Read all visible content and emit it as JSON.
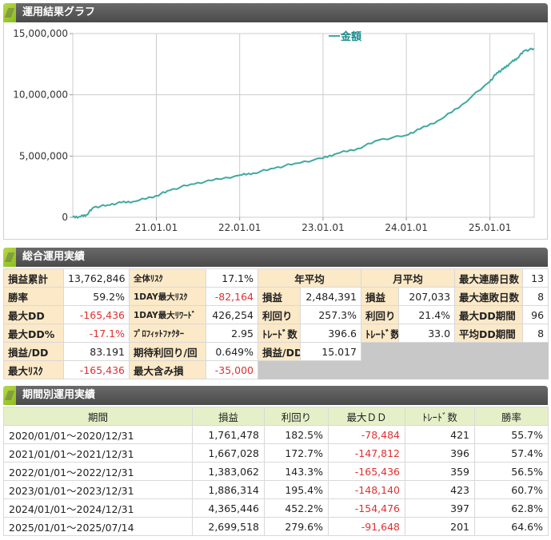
{
  "headers": {
    "chart": "運用結果グラフ",
    "summary": "総合運用実績",
    "period": "期間別運用実績"
  },
  "chart_data": {
    "type": "line",
    "title": "",
    "xlabel": "",
    "ylabel": "",
    "ylim": [
      0,
      15000000
    ],
    "yticks": [
      0,
      5000000,
      10000000,
      15000000
    ],
    "ytick_labels": [
      "0",
      "5,000,000",
      "10,000,000",
      "15,000,000"
    ],
    "xlim": [
      "2020-01-01",
      "2025-07-14"
    ],
    "xtick_labels": [
      "21.01.01",
      "22.01.01",
      "23.01.01",
      "24.01.01",
      "25.01.01"
    ],
    "grid": true,
    "legend": "top-center",
    "line_color": "#3fa9a0",
    "series": [
      {
        "name": "金額",
        "x": [
          "2020-01-01",
          "2020-02-01",
          "2020-03-01",
          "2020-04-01",
          "2020-06-01",
          "2020-08-01",
          "2020-10-01",
          "2020-12-31",
          "2021-03-01",
          "2021-06-01",
          "2021-09-01",
          "2021-12-31",
          "2022-03-01",
          "2022-06-01",
          "2022-09-01",
          "2022-12-31",
          "2023-03-01",
          "2023-06-01",
          "2023-09-01",
          "2023-12-31",
          "2024-03-01",
          "2024-06-01",
          "2024-09-01",
          "2024-12-31",
          "2025-02-01",
          "2025-03-01",
          "2025-04-01",
          "2025-05-01",
          "2025-06-01",
          "2025-07-14"
        ],
        "values": [
          0,
          50000,
          200000,
          800000,
          1000000,
          1200000,
          1300000,
          1761478,
          2200000,
          2700000,
          3000000,
          3428506,
          3600000,
          4000000,
          4400000,
          4811568,
          5200000,
          5600000,
          6300000,
          6697882,
          7200000,
          8000000,
          9200000,
          11063328,
          11800000,
          12100000,
          12600000,
          13000000,
          13600000,
          13762846
        ]
      }
    ]
  },
  "summary": {
    "rows": [
      [
        {
          "label": "損益累計"
        },
        {
          "value": "13,762,846"
        },
        {
          "label": "全体ﾘｽｸ",
          "small": true
        },
        {
          "value": "17.1%"
        },
        {
          "header": "年平均",
          "span": 2
        },
        {
          "header": "月平均",
          "span": 2
        },
        {
          "label": "最大連勝日数"
        },
        {
          "value": "13"
        }
      ],
      [
        {
          "label": "勝率"
        },
        {
          "value": "59.2%"
        },
        {
          "label": "1DAY最大ﾘｽｸ",
          "small": true
        },
        {
          "value": "-82,164",
          "neg": true
        },
        {
          "label": "損益"
        },
        {
          "value": "2,484,391"
        },
        {
          "label": "損益"
        },
        {
          "value": "207,033"
        },
        {
          "label": "最大連敗日数"
        },
        {
          "value": "8"
        }
      ],
      [
        {
          "label": "最大DD"
        },
        {
          "value": "-165,436",
          "neg": true
        },
        {
          "label": "1DAY最大ﾘﾜｰﾄﾞ",
          "small": true
        },
        {
          "value": "426,254"
        },
        {
          "label": "利回り"
        },
        {
          "value": "257.3%"
        },
        {
          "label": "利回り"
        },
        {
          "value": "21.4%"
        },
        {
          "label": "最大DD期間"
        },
        {
          "value": "96"
        }
      ],
      [
        {
          "label": "最大DD%"
        },
        {
          "value": "-17.1%",
          "neg": true
        },
        {
          "label": "ﾌﾟﾛﾌｨｯﾄﾌｧｸﾀｰ",
          "small": true
        },
        {
          "value": "2.95"
        },
        {
          "label": "ﾄﾚｰﾄﾞ数"
        },
        {
          "value": "396.6"
        },
        {
          "label": "ﾄﾚｰﾄﾞ数"
        },
        {
          "value": "33.0"
        },
        {
          "label": "平均DD期間"
        },
        {
          "value": "8"
        }
      ],
      [
        {
          "label": "損益/DD"
        },
        {
          "value": "83.191"
        },
        {
          "label": "期待利回り/回"
        },
        {
          "value": "0.649%"
        },
        {
          "label": "損益/DD"
        },
        {
          "value": "15.017"
        },
        {
          "gray": true,
          "span": 4
        }
      ],
      [
        {
          "label": "最大ﾘｽｸ"
        },
        {
          "value": "-165,436",
          "neg": true
        },
        {
          "label": "最大含み損"
        },
        {
          "value": "-35,000",
          "neg": true
        },
        {
          "gray": true,
          "span": 6
        }
      ]
    ]
  },
  "period": {
    "columns": [
      "期間",
      "損益",
      "利回り",
      "最大ＤＤ",
      "ﾄﾚｰﾄﾞ数",
      "勝率"
    ],
    "rows": [
      [
        "2020/01/01～2020/12/31",
        "1,761,478",
        "182.5%",
        "-78,484",
        "421",
        "55.7%"
      ],
      [
        "2021/01/01～2021/12/31",
        "1,667,028",
        "172.7%",
        "-147,812",
        "396",
        "57.4%"
      ],
      [
        "2022/01/01～2022/12/31",
        "1,383,062",
        "143.3%",
        "-165,436",
        "359",
        "56.5%"
      ],
      [
        "2023/01/01～2023/12/31",
        "1,886,314",
        "195.4%",
        "-148,140",
        "423",
        "60.7%"
      ],
      [
        "2024/01/01～2024/12/31",
        "4,365,446",
        "452.2%",
        "-154,476",
        "397",
        "62.8%"
      ],
      [
        "2025/01/01～2025/07/14",
        "2,699,518",
        "279.6%",
        "-91,648",
        "201",
        "64.6%"
      ]
    ]
  }
}
